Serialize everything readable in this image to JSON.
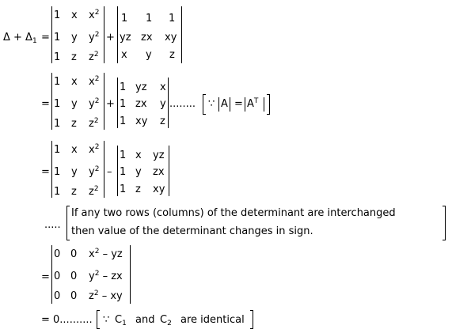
{
  "equations": {
    "lhs": "Δ + Δ",
    "lhs_sub": "1",
    "eq": "=",
    "plus": "+",
    "minus": "–",
    "step1": {
      "m1": [
        [
          "1",
          "x",
          "x",
          "2"
        ],
        [
          "1",
          "y",
          "y",
          "2"
        ],
        [
          "1",
          "z",
          "z",
          "2"
        ]
      ],
      "m2": [
        [
          "1",
          "1",
          "1"
        ],
        [
          "yz",
          "zx",
          "xy"
        ],
        [
          "x",
          "y",
          "z"
        ]
      ]
    },
    "step2": {
      "m2": [
        [
          "1",
          "yz",
          "x"
        ],
        [
          "1",
          "zx",
          "y"
        ],
        [
          "1",
          "xy",
          "z"
        ]
      ],
      "dots": "........",
      "reason_because": "∵",
      "reason_A": "A",
      "reason_eq": "=",
      "reason_AT": "A",
      "reason_T": "T"
    },
    "step3": {
      "m2": [
        [
          "1",
          "x",
          "yz"
        ],
        [
          "1",
          "y",
          "zx"
        ],
        [
          "1",
          "z",
          "xy"
        ]
      ]
    },
    "note": {
      "dots": ".....",
      "line1": "If any two rows (columns) of the determinant are interchanged",
      "line2": "then value of the determinant changes in sign."
    },
    "step4": {
      "m": [
        [
          "0",
          "0",
          "x",
          "2",
          " – yz"
        ],
        [
          "0",
          "0",
          "y",
          "2",
          " – zx"
        ],
        [
          "0",
          "0",
          "z",
          "2",
          " – xy"
        ]
      ]
    },
    "final": {
      "value": "= 0..........",
      "because": "∵",
      "c": "C",
      "c1": "1",
      "and": "and",
      "c2": "2",
      "tail": "are identical"
    }
  }
}
